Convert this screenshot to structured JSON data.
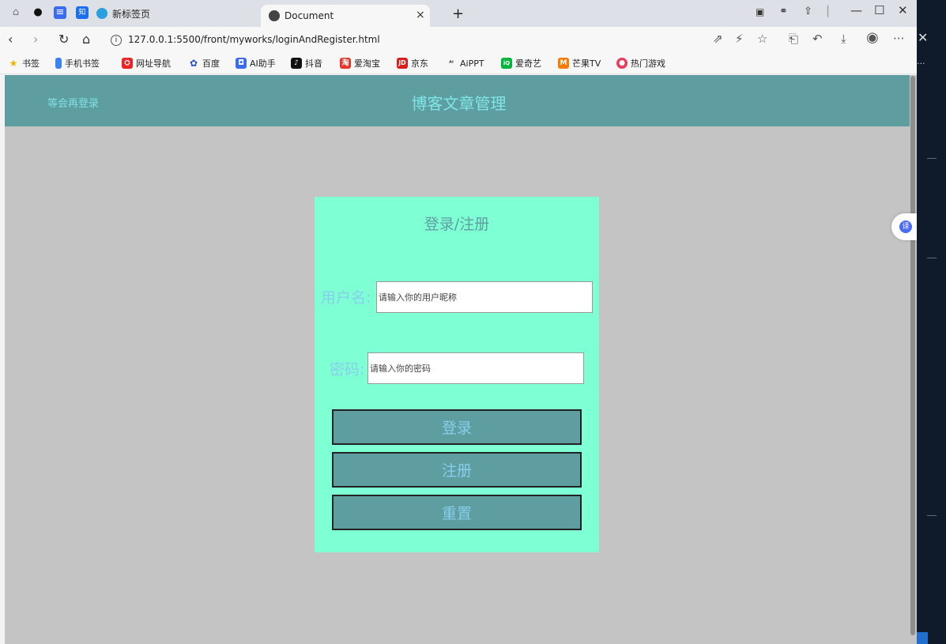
{
  "tabs": [
    {
      "label": "新标签页"
    },
    {
      "label": "Document"
    }
  ],
  "address": {
    "url": "127.0.0.1:5500/front/myworks/loginAndRegister.html"
  },
  "bookmarks": [
    {
      "label": "书签",
      "icon": "star-icon"
    },
    {
      "label": "手机书签",
      "icon": "bookmark-icon"
    },
    {
      "label": "网址导航",
      "icon": "nav-icon"
    },
    {
      "label": "百度",
      "icon": "baidu-icon"
    },
    {
      "label": "AI助手",
      "icon": "ai-icon"
    },
    {
      "label": "抖音",
      "icon": "douyin-icon"
    },
    {
      "label": "爱淘宝",
      "icon": "taobao-icon"
    },
    {
      "label": "京东",
      "icon": "jd-icon"
    },
    {
      "label": "AiPPT",
      "icon": "aippt-icon"
    },
    {
      "label": "爱奇艺",
      "icon": "iqiyi-icon"
    },
    {
      "label": "芒果TV",
      "icon": "mango-icon"
    },
    {
      "label": "热门游戏",
      "icon": "game-icon"
    }
  ],
  "header": {
    "later_link": "等会再登录",
    "title": "博客文章管理"
  },
  "form": {
    "heading": "登录/注册",
    "username_label": "用户名:",
    "username_placeholder": "请输入你的用户昵称",
    "password_label": "密码:",
    "password_placeholder": "请输入你的密码",
    "login_button": "登录",
    "register_button": "注册",
    "reset_button": "重置"
  },
  "colors": {
    "header": "#5f9ea0",
    "card": "#7fffd4",
    "label": "#87ceeb",
    "page_bg": "#c4c4c4"
  }
}
